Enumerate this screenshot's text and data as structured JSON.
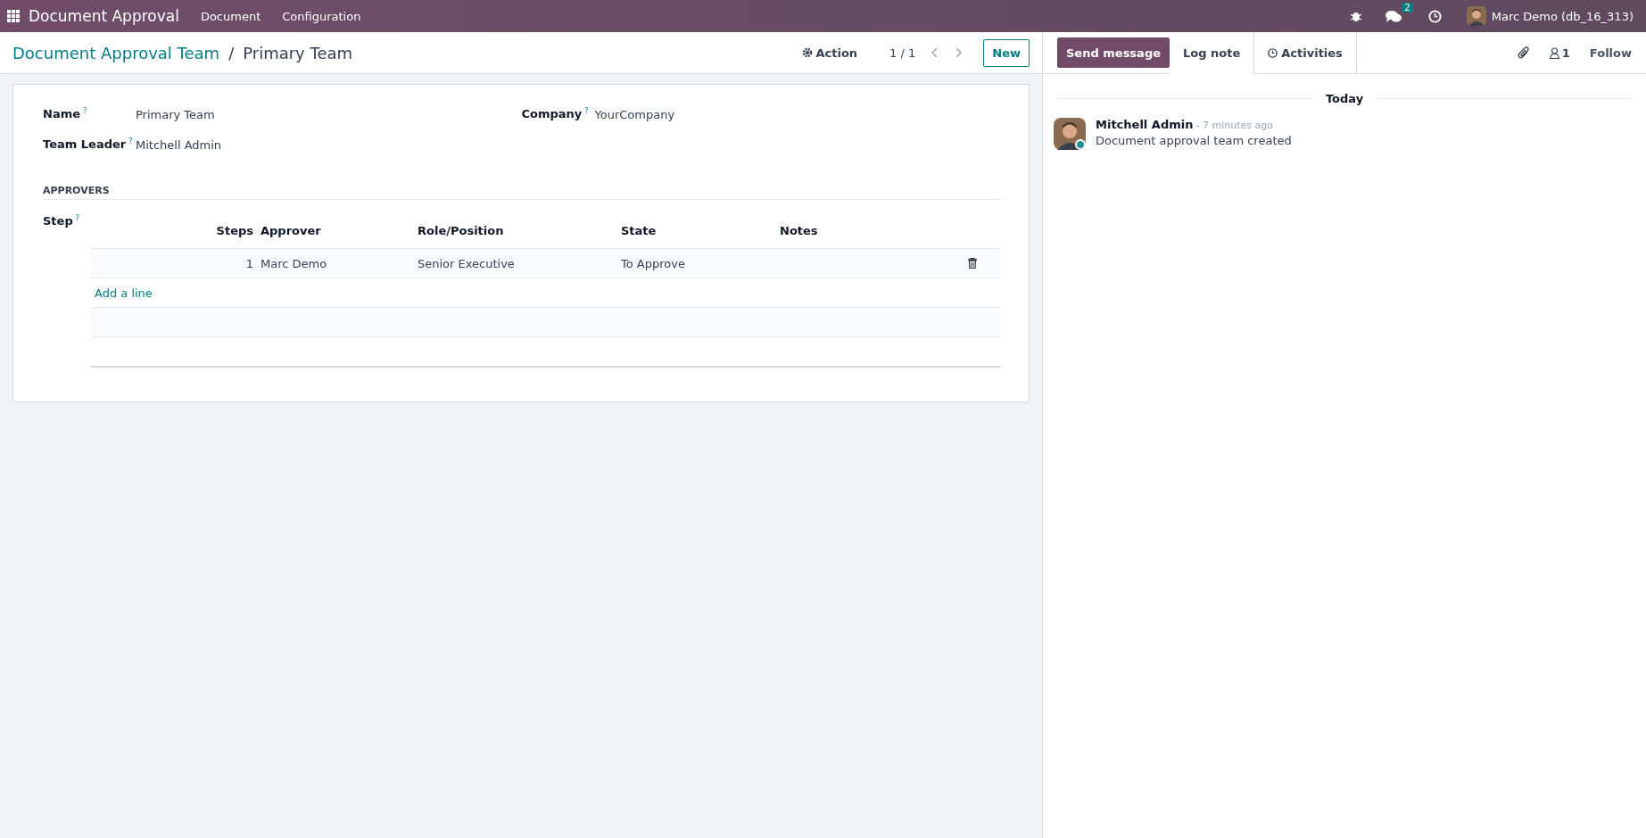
{
  "navbar": {
    "app_name": "Document Approval",
    "menus": [
      "Document",
      "Configuration"
    ],
    "message_count": "2",
    "user": "Marc Demo (db_16_313)"
  },
  "control_panel": {
    "breadcrumb": "Document Approval Team",
    "separator": "/",
    "title": "Primary Team",
    "action": "Action",
    "pager": "1 / 1",
    "new_button": "New"
  },
  "form": {
    "fields_left": [
      {
        "label": "Name",
        "help": "?",
        "value": "Primary Team"
      },
      {
        "label": "Team Leader",
        "help": "?",
        "value": "Mitchell Admin"
      }
    ],
    "fields_right": [
      {
        "label": "Company",
        "help": "?",
        "value": "YourCompany"
      }
    ],
    "section": "APPROVERS",
    "step_label": "Step",
    "step_help": "?",
    "table": {
      "columns": [
        "Steps",
        "Approver",
        "Role/Position",
        "State",
        "Notes"
      ],
      "rows": [
        {
          "steps": "1",
          "approver": "Marc Demo",
          "role": "Senior Executive",
          "state": "To Approve"
        }
      ],
      "add_line": "Add a line"
    }
  },
  "chatter": {
    "tabs": [
      {
        "label": "Send message",
        "selected": true,
        "kind": "primary"
      },
      {
        "label": "Log note",
        "selected": false,
        "kind": "tab"
      },
      {
        "label": "Activities",
        "selected": false,
        "kind": "activities"
      }
    ],
    "followers": "1",
    "follow": "Follow",
    "date_separator": "Today",
    "messages": [
      {
        "author": "Mitchell Admin",
        "time": "- 7 minutes ago",
        "body": "Document approval team created"
      }
    ]
  }
}
